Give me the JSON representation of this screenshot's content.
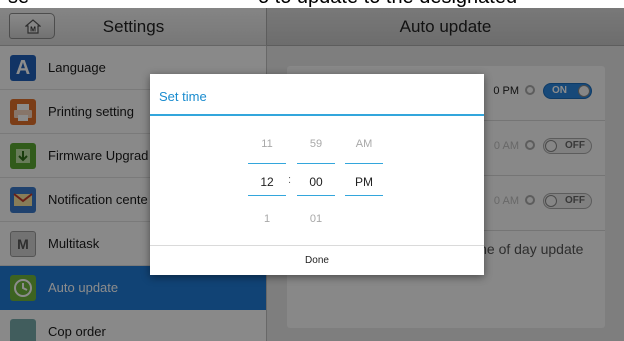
{
  "caption": {
    "left_text": "se",
    "right_text": "o to update to the designated"
  },
  "header": {
    "left_title": "Settings",
    "right_title": "Auto update",
    "home_icon_letter": "M"
  },
  "sidebar": {
    "items": [
      {
        "label": "Language",
        "icon": "language-icon",
        "icon_letter": "A"
      },
      {
        "label": "Printing setting",
        "icon": "printer-icon"
      },
      {
        "label": "Firmware Upgrad",
        "icon": "firmware-icon"
      },
      {
        "label": "Notification cente",
        "icon": "notification-icon"
      },
      {
        "label": "Multitask",
        "icon": "multitask-icon",
        "icon_letter": "M"
      },
      {
        "label": "Auto update",
        "icon": "auto-update-icon",
        "active": true
      },
      {
        "label": "Cop order",
        "icon": "recorder-icon"
      }
    ]
  },
  "auto_update": {
    "rows": [
      {
        "time": "0 PM",
        "toggle": "ON",
        "enabled": true
      },
      {
        "time": "0 AM",
        "toggle": "OFF",
        "enabled": false
      },
      {
        "time": "0 AM",
        "toggle": "OFF",
        "enabled": false
      }
    ],
    "description": "at this time of day update"
  },
  "dialog": {
    "title": "Set time",
    "hour": {
      "prev": "11",
      "current": "12",
      "next": "1"
    },
    "minute": {
      "prev": "59",
      "current": "00",
      "next": "01"
    },
    "ampm": {
      "prev": "AM",
      "current": "PM",
      "next": ""
    },
    "separator": ":",
    "done_label": "Done"
  },
  "colors": {
    "accent": "#33a6dc",
    "active_item": "#1f7bd6",
    "toggle_on": "#2a86dc"
  }
}
